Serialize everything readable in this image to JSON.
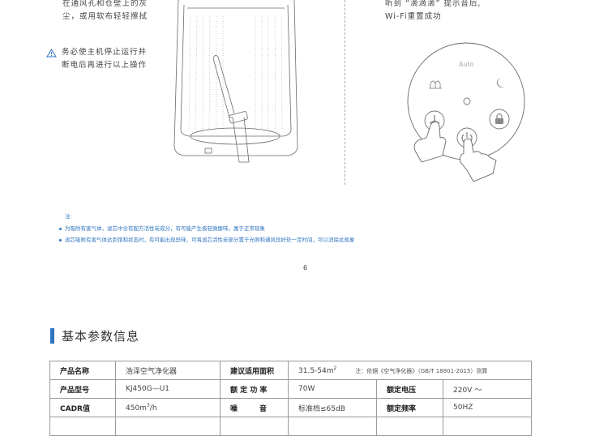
{
  "left_caption": {
    "line1": "在通风孔和仓壁上的灰",
    "line2": "尘，或用软布轻轻擦拭"
  },
  "warning": {
    "icon": "warning-triangle-icon",
    "line1": "务必使主机停止运行并",
    "line2": "断电后再进行以上操作"
  },
  "right_caption": {
    "line1": "听到 “滴滴滴” 提示音后,",
    "line2": "Wi-Fi重置成功"
  },
  "control_panel": {
    "auto_label": "Auto",
    "icons": [
      "fan-speed-icon",
      "sleep-moon-icon",
      "center-indicator",
      "child-lock-icon",
      "power-icon"
    ]
  },
  "notes": {
    "label": "注:",
    "items": [
      "为吸附有害气体，滤芯中含有配方活性炭成分，有可能产生极轻微酸味，属于正常现象",
      "滤芯吸附有害气体达到饱和状态时，有可能出现异味，可将滤芯活性炭部分置于光照和通风良好处一定时间，可以消除此现象"
    ]
  },
  "page_number": "6",
  "section_title": "基本参数信息",
  "spec_table": {
    "rows": [
      {
        "label1": "产品名称",
        "value1": "浩泽空气净化器",
        "label2": "建议适用面积",
        "value2": "31.5-54m",
        "value2_sup": "2",
        "value2_note": "注：依据《空气净化器》（GB/T 18801-2015）测算"
      },
      {
        "label1": "产品型号",
        "value1": "KJ450G—U1",
        "label2": "额 定 功 率",
        "value2": "70W",
        "label3": "额定电压",
        "value3": "220V ～"
      },
      {
        "label1": "CADR值",
        "value1": "450m",
        "value1_sup": "3",
        "value1_tail": "/h",
        "label2": "噪　　　音",
        "value2": "标准档≤65dB",
        "label3": "额定频率",
        "value3": "50HZ"
      }
    ]
  },
  "colors": {
    "accent": "#2e74c0",
    "line": "#9a9a9a",
    "drawing": "#6a6a6a"
  }
}
